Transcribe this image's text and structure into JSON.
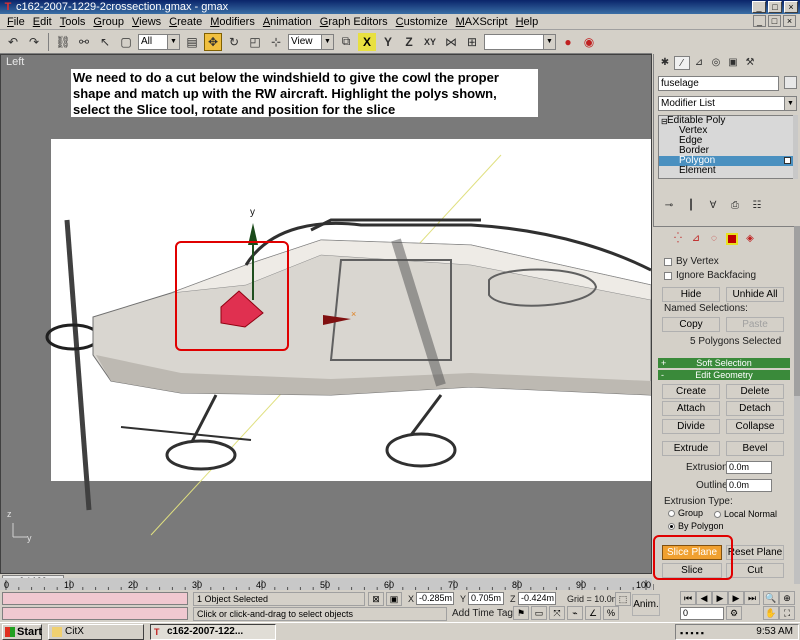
{
  "window": {
    "title": "c162-2007-1229-2crossection.gmax - gmax",
    "minimize": "_",
    "maximize": "□",
    "close": "×"
  },
  "menu": {
    "items": [
      {
        "label": "File",
        "accel": "F",
        "rest": "ile"
      },
      {
        "label": "Edit",
        "accel": "E",
        "rest": "dit"
      },
      {
        "label": "Tools",
        "accel": "T",
        "rest": "ools"
      },
      {
        "label": "Group",
        "accel": "G",
        "rest": "roup"
      },
      {
        "label": "Views",
        "accel": "V",
        "rest": "iews"
      },
      {
        "label": "Create",
        "accel": "C",
        "rest": "reate"
      },
      {
        "label": "Modifiers",
        "accel": "M",
        "rest": "odifiers"
      },
      {
        "label": "Animation",
        "accel": "A",
        "rest": "nimation"
      },
      {
        "label": "Graph Editors",
        "accel": "G",
        "rest": "raph Editors"
      },
      {
        "label": "Customize",
        "accel": "C",
        "rest": "ustomize"
      },
      {
        "label": "MAXScript",
        "accel": "M",
        "rest": "AXScript"
      },
      {
        "label": "Help",
        "accel": "H",
        "rest": "elp"
      }
    ]
  },
  "toolbar": {
    "selection_filter": "All",
    "reference_coord": "View",
    "axis_x": "X",
    "axis_y": "Y",
    "axis_z": "Z",
    "axis_xy": "XY",
    "named_selection": ""
  },
  "viewport": {
    "label": "Left",
    "gizmo_y_label": "y",
    "axis_y": "y",
    "axis_z": "z",
    "axis_x": "x"
  },
  "callout": {
    "text": "We need to do a cut below the windshield to give the cowl the proper shape and match up with the RW aircraft.  Highlight the polys shown, select the Slice tool, rotate and position for the slice"
  },
  "timeline": {
    "position": "0 / 100",
    "ticks": [
      "0",
      "10",
      "20",
      "30",
      "40",
      "50",
      "60",
      "70",
      "80",
      "90",
      "100"
    ],
    "current_frame": 0,
    "range": [
      0,
      100
    ]
  },
  "status": {
    "selection_info": "1 Object Selected",
    "prompt": "Click or click-and-drag to select objects",
    "x_label": "X",
    "x_value": "-0.285m",
    "y_label": "Y",
    "y_value": "0.705m",
    "z_label": "Z",
    "z_value": "-0.424m",
    "grid": "Grid = 10.0m",
    "add_time_tag": "Add Time Tag",
    "anim": "Anim.",
    "frame_value": "0"
  },
  "panel": {
    "object_name": "fuselage",
    "modifier_list": "Modifier List",
    "stack": [
      {
        "label": "Editable Poly",
        "level": 0
      },
      {
        "label": "Vertex",
        "level": 1
      },
      {
        "label": "Edge",
        "level": 1
      },
      {
        "label": "Border",
        "level": 1
      },
      {
        "label": "Polygon",
        "level": 1,
        "selected": true
      },
      {
        "label": "Element",
        "level": 1
      }
    ],
    "by_vertex": "By Vertex",
    "ignore_backfacing": "Ignore Backfacing",
    "hide": "Hide",
    "unhide_all": "Unhide All",
    "named_selections": "Named Selections:",
    "copy": "Copy",
    "paste": "Paste",
    "selected_count": "5 Polygons Selected",
    "soft_selection": "Soft Selection",
    "edit_geometry": "Edit Geometry",
    "soft_selection_sign": "+",
    "edit_geometry_sign": "-",
    "create": "Create",
    "delete": "Delete",
    "attach": "Attach",
    "detach": "Detach",
    "divide": "Divide",
    "collapse": "Collapse",
    "extrude": "Extrude",
    "bevel": "Bevel",
    "extrusion_label": "Extrusion:",
    "extrusion_value": "0.0m",
    "outline_label": "Outline",
    "outline_value": "0.0m",
    "extrusion_type": "Extrusion Type:",
    "group": "Group",
    "local_normal": "Local Normal",
    "by_polygon": "By Polygon",
    "slice_plane": "Slice Plane",
    "reset_plane": "Reset Plane",
    "slice": "Slice",
    "cut": "Cut"
  },
  "taskbar": {
    "start": "Start",
    "tasks": [
      {
        "label": "CitX"
      },
      {
        "label": "c162-2007-122..."
      }
    ],
    "clock": "9:53 AM"
  },
  "colors": {
    "highlight_red": "#e00000",
    "selected_poly": "#e03050",
    "slice_plane_active": "#f0a030",
    "rollout_green": "#3a8a3a",
    "stack_selected": "#4a90c0"
  }
}
